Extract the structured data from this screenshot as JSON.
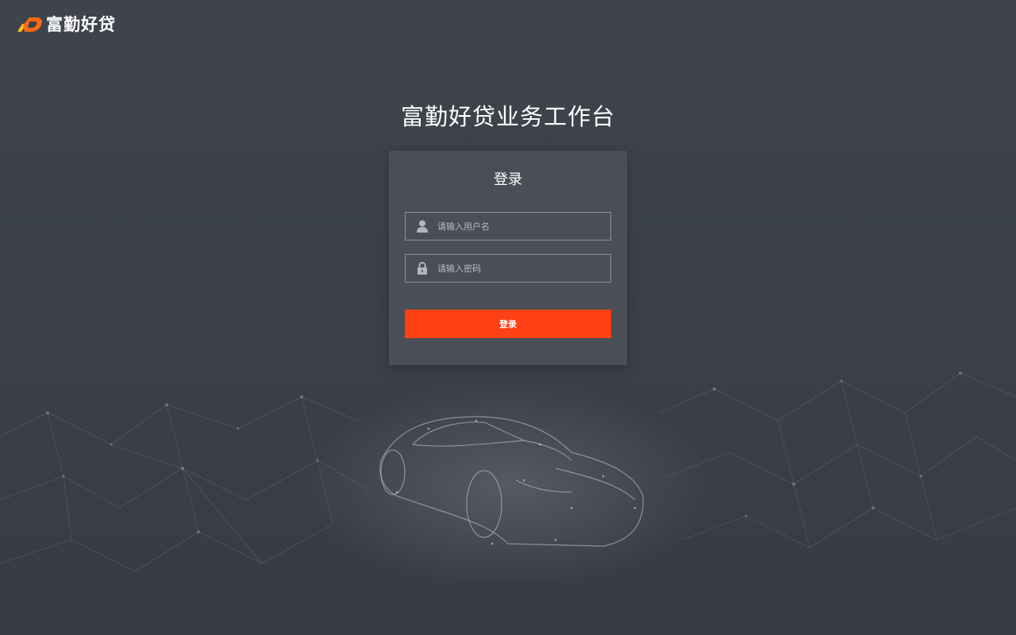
{
  "header": {
    "logo_text": "富勤好贷"
  },
  "headline": "富勤好贷业务工作台",
  "login_card": {
    "title": "登录",
    "username_placeholder": "请输入用户名",
    "password_placeholder": "请输入密码",
    "submit_label": "登录"
  },
  "colors": {
    "background": "#3c4149",
    "card": "#4a4f57",
    "accent": "#ff3f14",
    "logo_orange": "#ff6a13",
    "logo_yellow": "#ffc21a"
  },
  "icons": {
    "username": "user-icon",
    "password": "lock-icon"
  }
}
